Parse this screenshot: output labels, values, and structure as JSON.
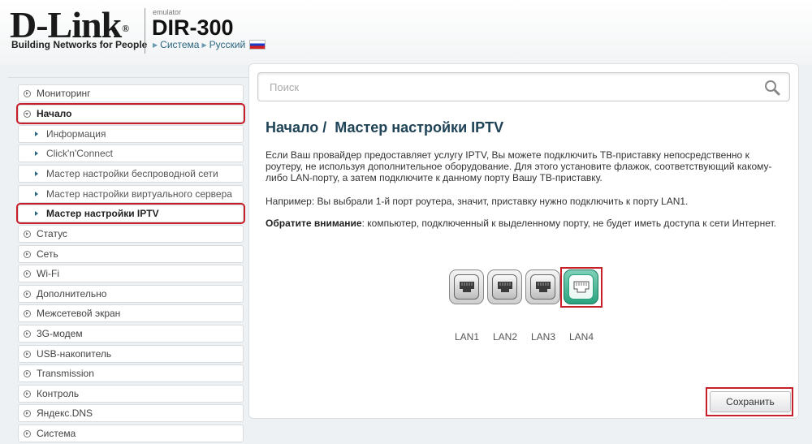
{
  "header": {
    "logo_text": "D-Link",
    "logo_registered": "®",
    "logo_tagline": "Building Networks for People",
    "emulator_label": "emulator",
    "model": "DIR-300",
    "crumb_system": "Система",
    "crumb_language": "Русский",
    "flag_icon": "russia-flag-icon"
  },
  "sidebar": {
    "items": [
      {
        "label": "Мониторинг"
      },
      {
        "label": "Начало"
      },
      {
        "label": "Информация"
      },
      {
        "label": "Click'n'Connect"
      },
      {
        "label": "Мастер настройки беспроводной сети"
      },
      {
        "label": "Мастер настройки виртуального сервера"
      },
      {
        "label": "Мастер настройки IPTV"
      },
      {
        "label": "Статус"
      },
      {
        "label": "Сеть"
      },
      {
        "label": "Wi-Fi"
      },
      {
        "label": "Дополнительно"
      },
      {
        "label": "Межсетевой экран"
      },
      {
        "label": "3G-модем"
      },
      {
        "label": "USB-накопитель"
      },
      {
        "label": "Transmission"
      },
      {
        "label": "Контроль"
      },
      {
        "label": "Яндекс.DNS"
      },
      {
        "label": "Система"
      }
    ]
  },
  "search": {
    "placeholder": "Поиск",
    "value": ""
  },
  "main": {
    "breadcrumb_section": "Начало /",
    "title": "Мастер настройки IPTV",
    "paragraph1": "Если Ваш провайдер предоставляет услугу IPTV, Вы можете подключить ТВ-приставку непосредственно к роутеру, не используя дополнительное оборудование. Для этого установите флажок, соответствующий какому-либо LAN-порту, а затем подключите к данному порту Вашу ТВ-приставку.",
    "paragraph2": "Например: Вы выбрали 1-й порт роутера, значит, приставку нужно подключить к порту LAN1.",
    "note_label": "Обратите внимание",
    "note_text": ": компьютер, подключенный к выделенному порту, не будет иметь доступа к сети Интернет.",
    "ports": [
      {
        "label": "LAN1",
        "selected": false
      },
      {
        "label": "LAN2",
        "selected": false
      },
      {
        "label": "LAN3",
        "selected": false
      },
      {
        "label": "LAN4",
        "selected": true
      }
    ],
    "save_label": "Сохранить"
  },
  "colors": {
    "highlight_red": "#c81e2a",
    "selected_port": "#2aa37e",
    "title_blue": "#1e4256"
  }
}
